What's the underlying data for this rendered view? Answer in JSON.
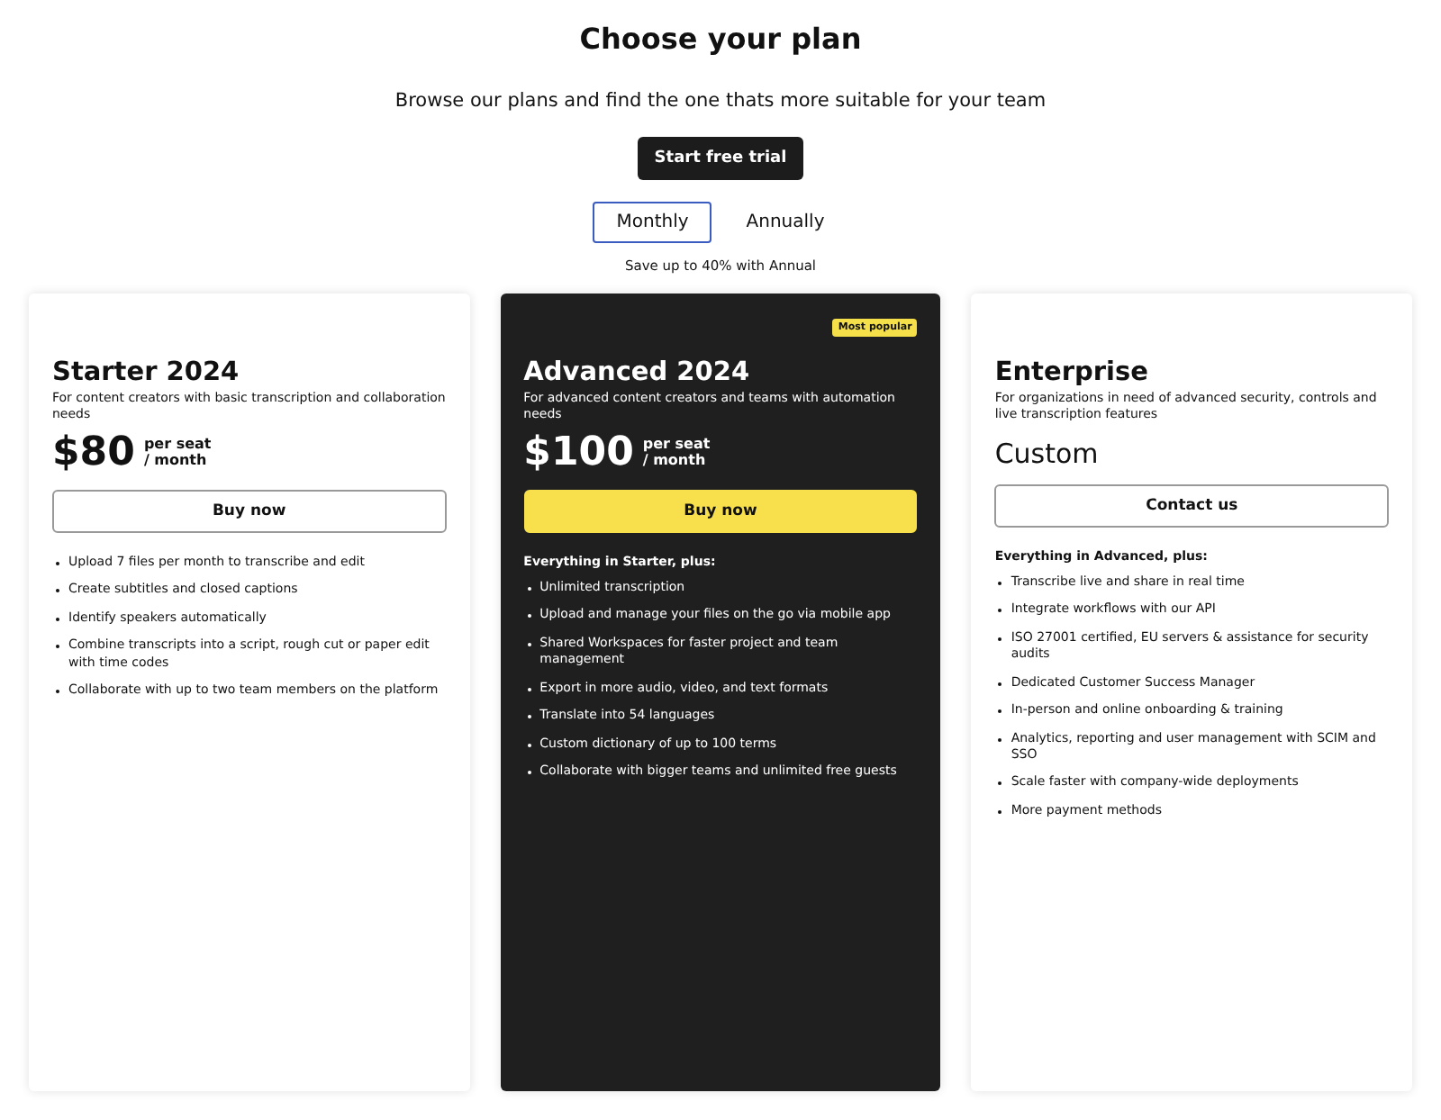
{
  "header": {
    "title": "Choose your plan",
    "subtitle": "Browse our plans and find the one thats more suitable for your team",
    "cta": "Start free trial"
  },
  "billing_toggle": [
    {
      "label": "Monthly",
      "selected": true
    },
    {
      "label": "Annually",
      "selected": false
    }
  ],
  "savings_note": "Save up to 40% with Annual",
  "plans": [
    {
      "kind": "light",
      "name": "Starter 2024",
      "description": "For content creators with basic transcription and collaboration needs",
      "price": {
        "kind": "amount",
        "amount": "$80",
        "unit_top": "per seat",
        "unit_bottom": "/ month"
      },
      "button": "Buy now",
      "features": [
        "Upload 7 files per month to transcribe and edit",
        "Create subtitles and closed captions",
        "Identify speakers automatically",
        "Combine transcripts into a script, rough cut or paper edit with time codes",
        "Collaborate with up to two team members on the platform"
      ]
    },
    {
      "kind": "dark",
      "badge": "Most popular",
      "name": "Advanced 2024",
      "description": "For advanced content creators and teams with automation needs",
      "price": {
        "kind": "amount",
        "amount": "$100",
        "unit_top": "per seat",
        "unit_bottom": "/ month"
      },
      "button": "Buy now",
      "features_heading": "Everything in Starter, plus:",
      "features": [
        "Unlimited transcription",
        "Upload and manage your files on the go via mobile app",
        "Shared Workspaces for faster project and team management",
        "Export in more audio, video, and text formats",
        "Translate into 54 languages",
        "Custom dictionary of up to 100 terms",
        "Collaborate with bigger teams and unlimited free guests"
      ]
    },
    {
      "kind": "light",
      "name": "Enterprise",
      "description": "For organizations in need of advanced security, controls and live transcription features",
      "price": {
        "kind": "custom",
        "amount": "Custom"
      },
      "button": "Contact us",
      "features_heading": "Everything in Advanced, plus:",
      "features": [
        "Transcribe live and share in real time",
        "Integrate workflows with our API",
        "ISO 27001 certified, EU servers & assistance for security audits",
        "Dedicated Customer Success Manager",
        "In-person and online onboarding & training",
        "Analytics, reporting and user management with SCIM and SSO",
        "Scale faster with company-wide deployments",
        "More payment methods"
      ]
    }
  ]
}
